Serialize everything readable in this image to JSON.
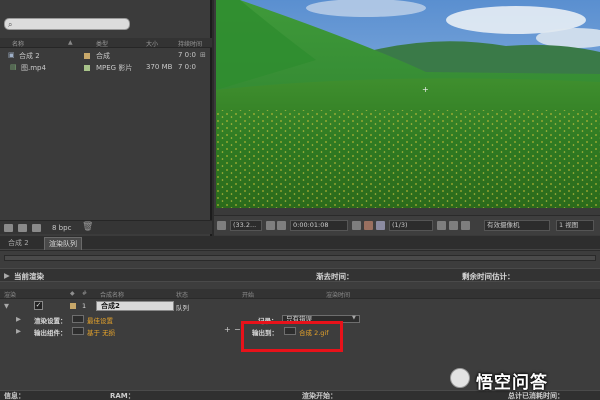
{
  "project": {
    "columns": [
      "名称",
      "类型",
      "大小",
      "持续时间"
    ],
    "items": [
      {
        "name": "合成 2",
        "type": "合成",
        "size": "",
        "duration": "7 0:0"
      },
      {
        "name": "图.mp4",
        "type": "MPEG 影片",
        "size": "370 MB",
        "duration": "7 0:0"
      }
    ],
    "bpc": "8 bpc"
  },
  "viewer": {
    "zoom": "(33.2...",
    "timecode": "0:00:01:08",
    "resolution": "(1/3)",
    "camera": "有效摄像机",
    "views": "1 视图"
  },
  "tabs": [
    {
      "label": "合成 2",
      "active": false
    },
    {
      "label": "渲染队列",
      "active": true
    }
  ],
  "render_queue": {
    "current_render": "当前渲染",
    "elapsed_label": "渐去时间：",
    "remaining_label": "剩余时间估计：",
    "columns": [
      "渲染",
      "",
      "#",
      "合成名称",
      "状态",
      "开始",
      "渲染时间"
    ],
    "item": {
      "index": "1",
      "comp_name": "合成2",
      "status": "队列"
    },
    "render_settings_label": "渲染设置：",
    "render_settings_value": "最佳设置",
    "output_module_label": "输出组件：",
    "output_module_value": "基于 无损",
    "log_label": "记录：",
    "log_value": "只有错误",
    "output_to_label": "输出到：",
    "output_to_value": "合成 2.gif",
    "status_bar": {
      "info": "信息：",
      "ram": "RAM：",
      "render_start": "渲染开始：",
      "total_elapsed": "总计已消耗时间："
    }
  },
  "watermark": {
    "text": "悟空问答"
  },
  "colors": {
    "accent_orange": "#e7a42b",
    "highlight_red": "#e8121a"
  }
}
